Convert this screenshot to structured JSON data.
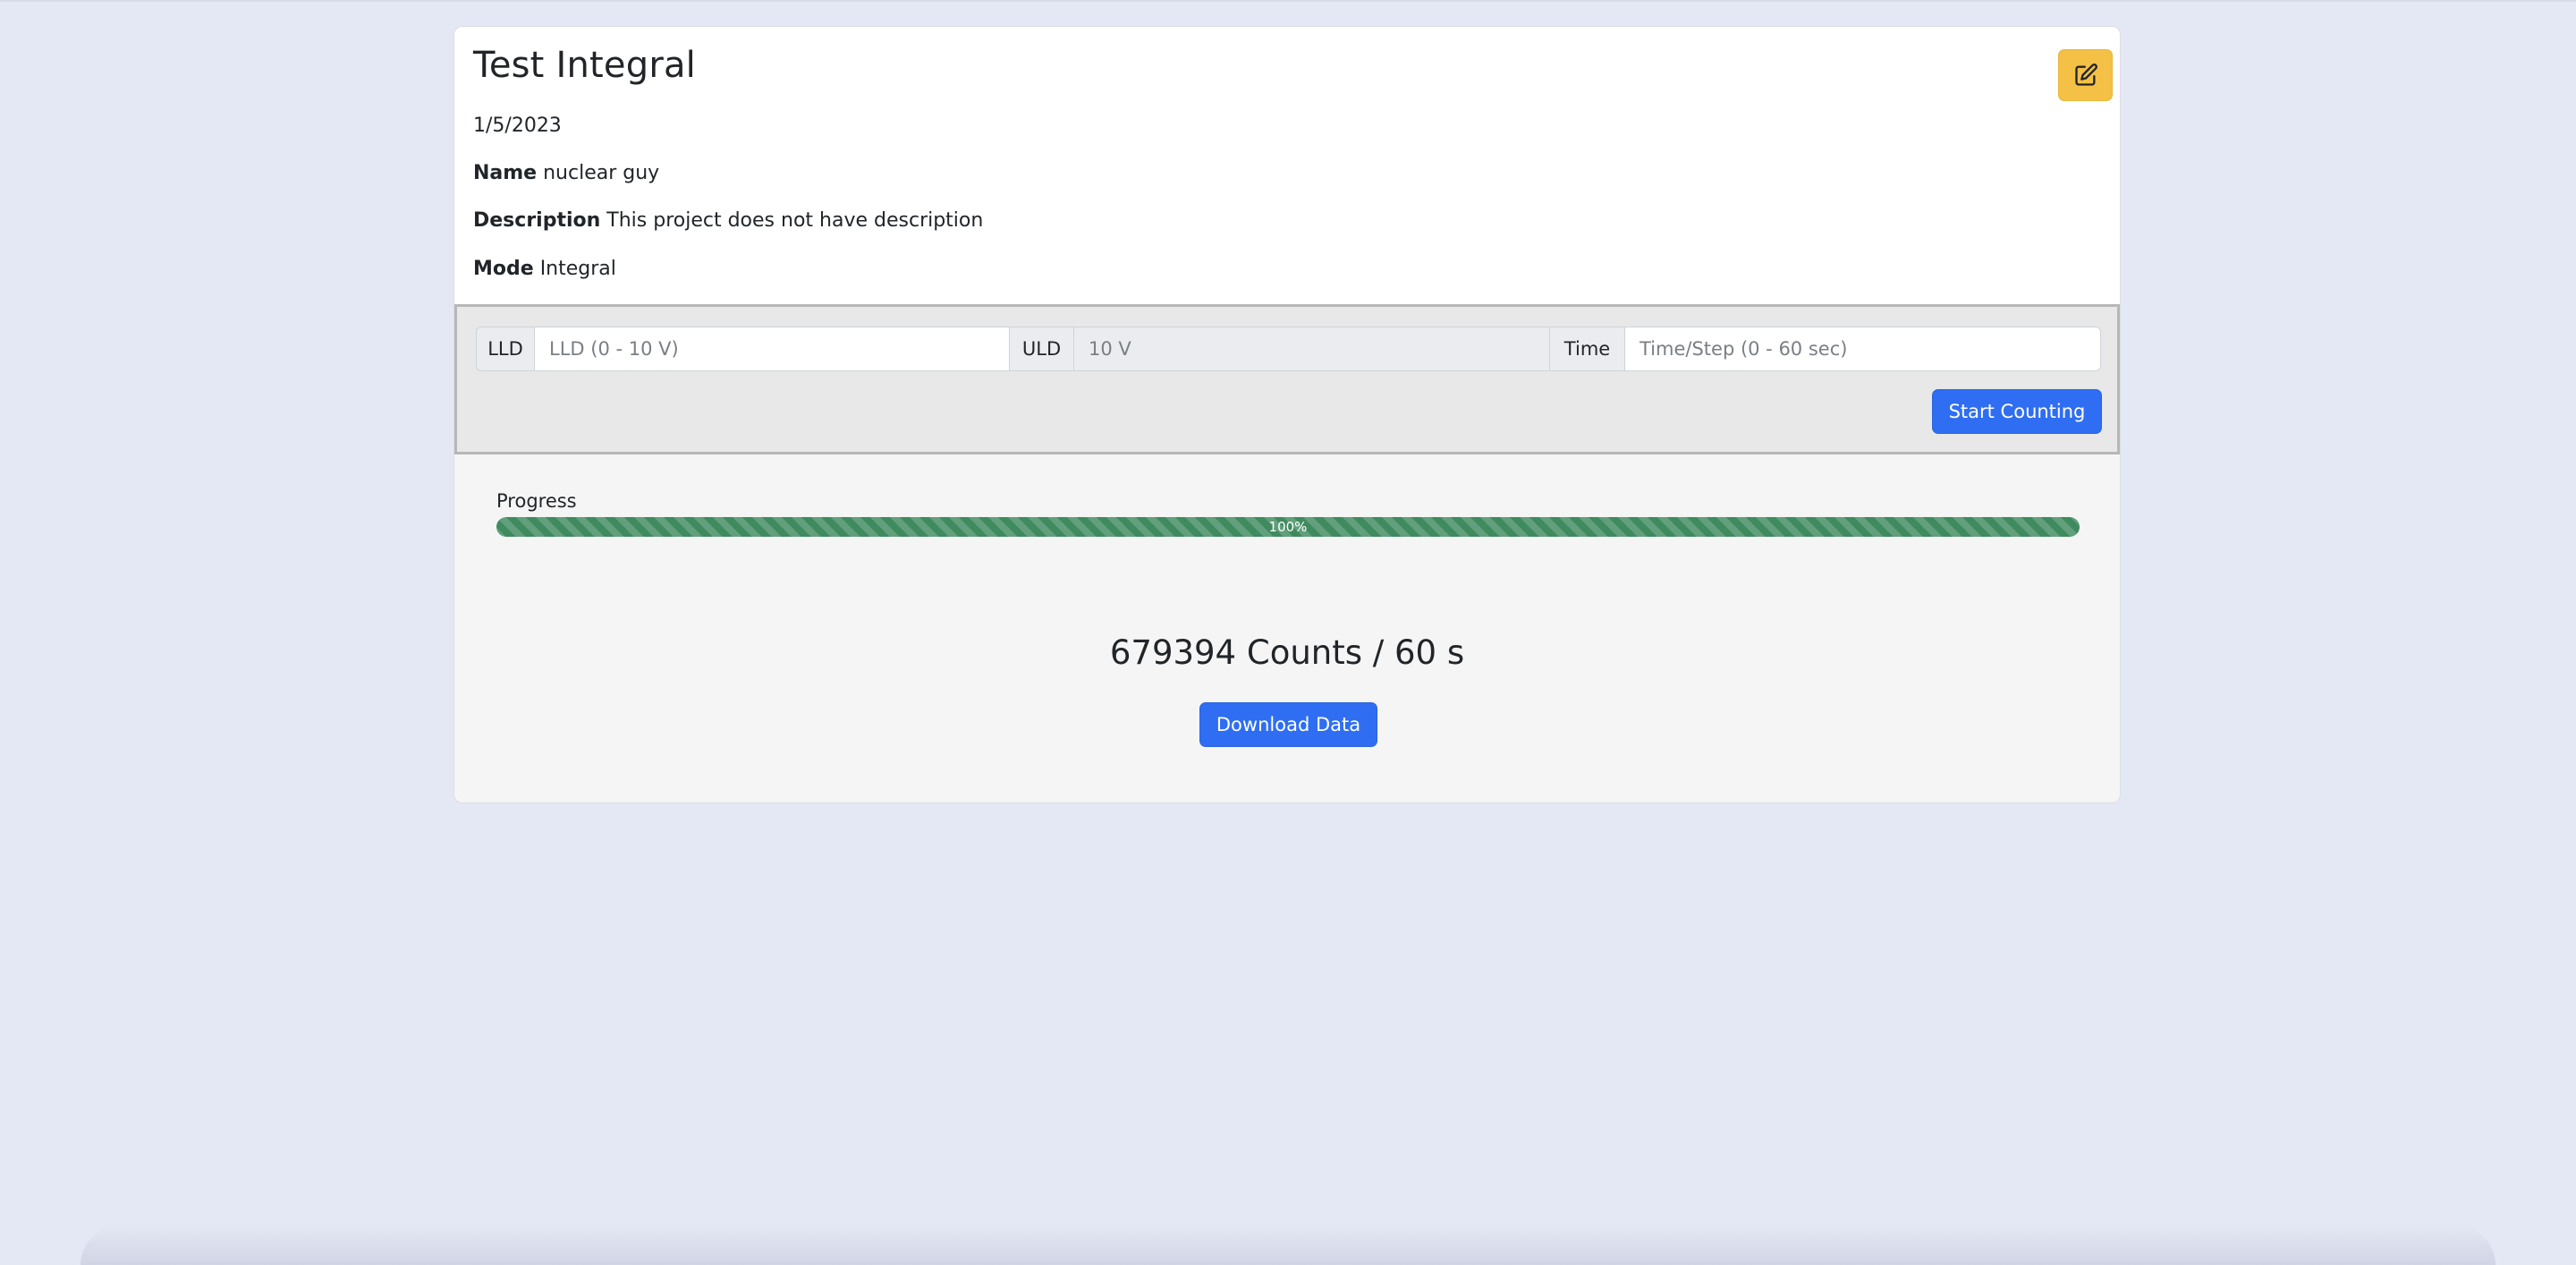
{
  "project": {
    "title": "Test Integral",
    "date": "1/5/2023",
    "name_label": "Name",
    "name_value": "nuclear guy",
    "description_label": "Description",
    "description_value": "This project does not have description",
    "mode_label": "Mode",
    "mode_value": "Integral"
  },
  "edit_button": {
    "icon": "edit-icon",
    "color": "#f4c146"
  },
  "controls": {
    "lld_label": "LLD",
    "lld_value": "",
    "lld_placeholder": "LLD (0 - 10 V)",
    "uld_label": "ULD",
    "uld_value": "",
    "uld_placeholder": "10 V",
    "time_label": "Time",
    "time_value": "",
    "time_placeholder": "Time/Step (0 - 60 sec)",
    "start_label": "Start Counting"
  },
  "progress": {
    "label": "Progress",
    "percent": 100,
    "percent_text": "100%",
    "color": "#3f8a5f"
  },
  "result": {
    "counts_text": "679394 Counts / 60 s",
    "download_label": "Download Data"
  },
  "colors": {
    "primary": "#2f6ef3",
    "warning": "#f4c146",
    "background": "#e4e8f4"
  }
}
